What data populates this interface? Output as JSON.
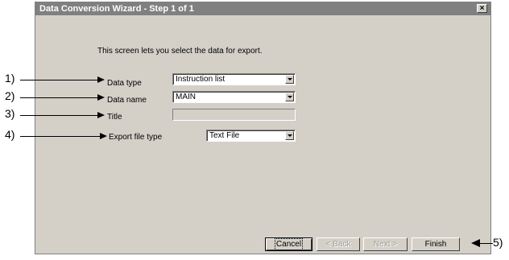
{
  "window": {
    "title": "Data Conversion Wizard - Step 1 of 1",
    "close_glyph": "×"
  },
  "intro_text": "This screen lets you select the data for export.",
  "fields": {
    "data_type": {
      "label": "Data type",
      "value": "Instruction list"
    },
    "data_name": {
      "label": "Data name",
      "value": "MAIN"
    },
    "title": {
      "label": "Title",
      "value": ""
    },
    "export_file_type": {
      "label": "Export file type",
      "value": "Text File"
    }
  },
  "buttons": {
    "cancel": "Cancel",
    "back": "< Back",
    "next": "Next >",
    "finish": "Finish"
  },
  "callouts": [
    "1)",
    "2)",
    "3)",
    "4)",
    "5)"
  ]
}
